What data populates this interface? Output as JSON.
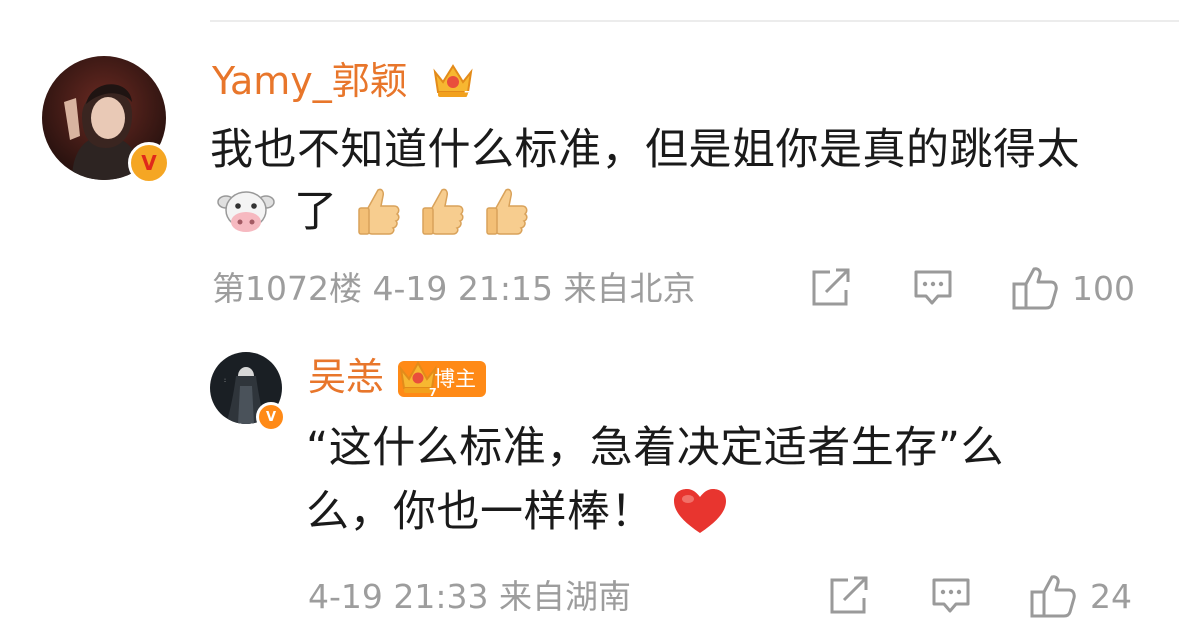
{
  "comment": {
    "username": "Yamy_郭颖",
    "text_line1": "我也不知道什么标准，但是姐你是真的跳得太",
    "text_line2": "了",
    "meta": "第1072楼 4-19 21:15 来自北京",
    "like_count": "100",
    "emojis": [
      "cow-face-emoji",
      "thumbs-up-emoji",
      "thumbs-up-emoji",
      "thumbs-up-emoji"
    ],
    "verified_badge": "V",
    "badge_color": "#f5a623"
  },
  "reply": {
    "username": "吴恙",
    "author_tag": "博主",
    "text_line1": "“这什么标准，急着决定适者生存”么",
    "text_line2": "么，你也一样棒！",
    "meta": "4-19 21:33 来自湖南",
    "like_count": "24",
    "emojis": [
      "red-heart-emoji"
    ],
    "verified_badge": "V",
    "badge_color": "#ff8a17"
  },
  "colors": {
    "username": "#e8762b",
    "text": "#1a1a1a",
    "meta": "#9d9d9d",
    "accent": "#ff8a17"
  }
}
